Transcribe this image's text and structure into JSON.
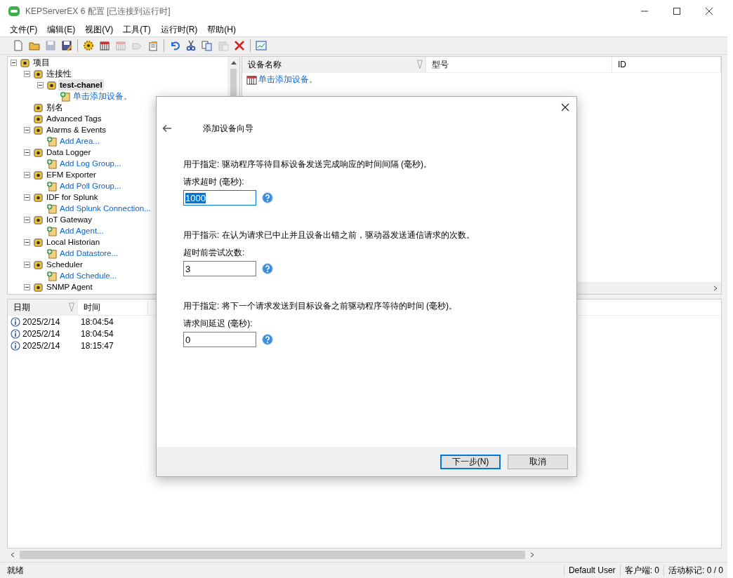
{
  "window": {
    "title": "KEPServerEX 6 配置 [已连接到运行时]"
  },
  "menu": [
    {
      "label": "文件(F)"
    },
    {
      "label": "编辑(E)"
    },
    {
      "label": "视图(V)"
    },
    {
      "label": "工具(T)"
    },
    {
      "label": "运行时(R)"
    },
    {
      "label": "帮助(H)"
    }
  ],
  "toolbar": [
    {
      "kind": "tool",
      "disabled": false
    },
    {
      "kind": "tool",
      "disabled": false
    },
    {
      "kind": "tool",
      "disabled": true
    },
    {
      "kind": "tool",
      "disabled": false
    },
    {
      "kind": "separator"
    },
    {
      "kind": "tool",
      "disabled": false
    },
    {
      "kind": "tool",
      "disabled": false
    },
    {
      "kind": "tool",
      "disabled": true
    },
    {
      "kind": "tool",
      "disabled": true
    },
    {
      "kind": "tool",
      "disabled": false
    },
    {
      "kind": "separator"
    },
    {
      "kind": "tool",
      "disabled": false
    },
    {
      "kind": "tool",
      "disabled": false
    },
    {
      "kind": "tool",
      "disabled": false
    },
    {
      "kind": "tool",
      "disabled": true
    },
    {
      "kind": "tool",
      "disabled": false
    },
    {
      "kind": "separator"
    },
    {
      "kind": "tool",
      "disabled": false
    }
  ],
  "tree": [
    {
      "label": "项目",
      "kind": "node",
      "selected": false,
      "expanded": true,
      "children": [
        {
          "label": "连接性",
          "kind": "node",
          "selected": false,
          "expanded": true,
          "children": [
            {
              "label": "test-chanel",
              "kind": "node",
              "selected": true,
              "expanded": true,
              "children": [
                {
                  "label": "单击添加设备。",
                  "kind": "link",
                  "selected": false
                }
              ]
            }
          ]
        },
        {
          "label": "别名",
          "kind": "node",
          "selected": false
        },
        {
          "label": "Advanced Tags",
          "kind": "node",
          "selected": false
        },
        {
          "label": "Alarms & Events",
          "kind": "node",
          "selected": false,
          "expanded": true,
          "children": [
            {
              "label": "Add Area...",
              "kind": "link",
              "selected": false
            }
          ]
        },
        {
          "label": "Data Logger",
          "kind": "node",
          "selected": false,
          "expanded": true,
          "children": [
            {
              "label": "Add Log Group...",
              "kind": "link",
              "selected": false
            }
          ]
        },
        {
          "label": "EFM Exporter",
          "kind": "node",
          "selected": false,
          "expanded": true,
          "children": [
            {
              "label": "Add Poll Group...",
              "kind": "link",
              "selected": false
            }
          ]
        },
        {
          "label": "IDF for Splunk",
          "kind": "node",
          "selected": false,
          "expanded": true,
          "children": [
            {
              "label": "Add Splunk Connection...",
              "kind": "link",
              "selected": false
            }
          ]
        },
        {
          "label": "IoT Gateway",
          "kind": "node",
          "selected": false,
          "expanded": true,
          "children": [
            {
              "label": "Add Agent...",
              "kind": "link",
              "selected": false
            }
          ]
        },
        {
          "label": "Local Historian",
          "kind": "node",
          "selected": false,
          "expanded": true,
          "children": [
            {
              "label": "Add Datastore...",
              "kind": "link",
              "selected": false
            }
          ]
        },
        {
          "label": "Scheduler",
          "kind": "node",
          "selected": false,
          "expanded": true,
          "children": [
            {
              "label": "Add Schedule...",
              "kind": "link",
              "selected": false
            }
          ]
        },
        {
          "label": "SNMP Agent",
          "kind": "node",
          "selected": false,
          "expanded": true
        }
      ]
    }
  ],
  "device_list": {
    "columns": [
      {
        "label": "设备名称",
        "sorted": true
      },
      {
        "label": "型号",
        "sorted": false
      },
      {
        "label": "ID",
        "sorted": false
      }
    ],
    "add_link": "单击添加设备。"
  },
  "event_log": {
    "columns": [
      {
        "label": "日期",
        "sorted": true
      },
      {
        "label": "时间",
        "sorted": false
      }
    ],
    "rows": [
      {
        "date": "2025/2/14",
        "time": "18:04:54"
      },
      {
        "date": "2025/2/14",
        "time": "18:04:54"
      },
      {
        "date": "2025/2/14",
        "time": "18:15:47"
      }
    ]
  },
  "dialog": {
    "title": "添加设备向导",
    "sections": [
      {
        "description": "用于指定: 驱动程序等待目标设备发送完成响应的时间间隔 (毫秒)。",
        "label": "请求超时 (毫秒):",
        "value": "1000",
        "selected": true
      },
      {
        "description": "用于指示: 在认为请求已中止并且设备出错之前，驱动器发送通信请求的次数。",
        "label": "超时前尝试次数:",
        "value": "3",
        "selected": false
      },
      {
        "description": "用于指定: 将下一个请求发送到目标设备之前驱动程序等待的时间 (毫秒)。",
        "label": "请求间延迟 (毫秒):",
        "value": "0",
        "selected": false
      }
    ],
    "buttons": [
      {
        "label": "下一步(N)",
        "default": true
      },
      {
        "label": "取消",
        "default": false
      }
    ]
  },
  "status_bar": {
    "status": "就绪",
    "user": "Default User",
    "clients": "客户端: 0",
    "active_tags": "活动标记: 0 / 0"
  }
}
